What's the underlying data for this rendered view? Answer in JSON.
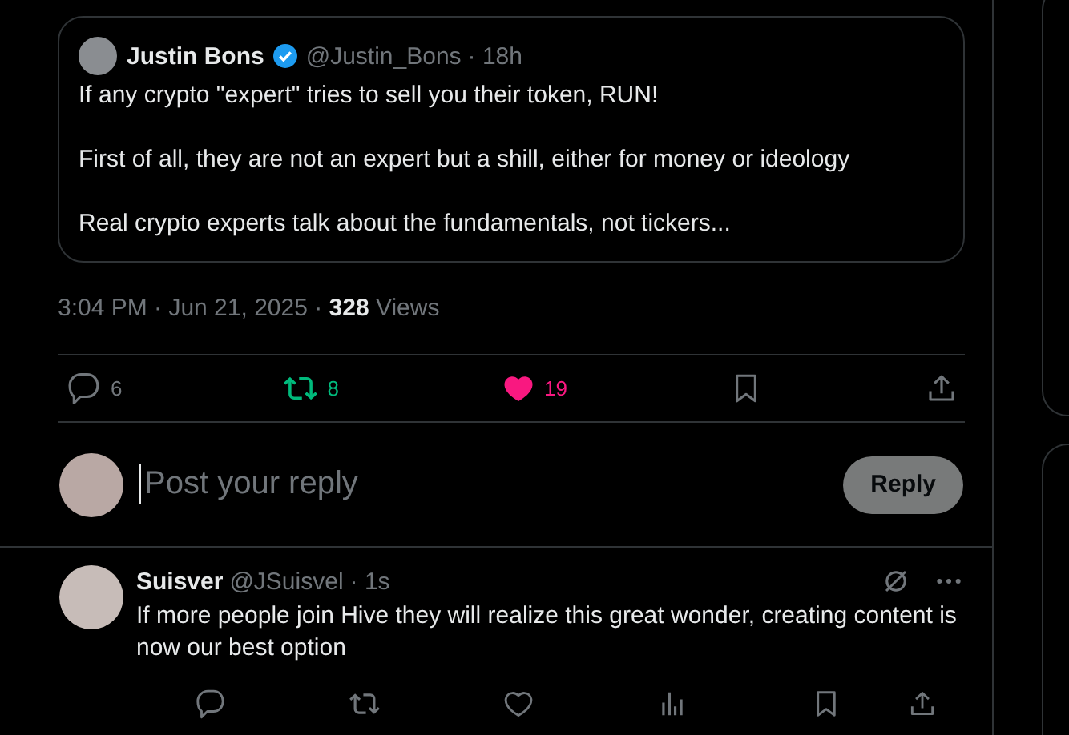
{
  "quoted_post": {
    "author": "Justin Bons",
    "verified": true,
    "handle": "@Justin_Bons",
    "time": "· 18h",
    "text": "If any crypto \"expert\" tries to sell you their token, RUN!\n\nFirst of all, they are not an expert but a shill, either for money or ideology\n\nReal crypto experts talk about the fundamentals, not tickers..."
  },
  "post_meta": "3:04 PM · Jun 21, 2025 · **328** Views",
  "post_actions": [
    {
      "kind": "reply",
      "count": "6",
      "on": false
    },
    {
      "kind": "retweet",
      "count": "8",
      "on": true
    },
    {
      "kind": "like",
      "count": "19",
      "on": true
    },
    {
      "kind": "bookmark",
      "on": false
    },
    {
      "kind": "share"
    }
  ],
  "composer": {
    "placeholder": "Post your reply",
    "button": "Reply",
    "disabled": true
  },
  "reply": {
    "author": "Suisver",
    "handle": "@JSuisvel",
    "time": "· 1s",
    "text": "If more people join Hive they will realize this great wonder, creating content is now our best option",
    "actions": [
      {
        "kind": "reply",
        "on": false
      },
      {
        "kind": "retweet",
        "on": false
      },
      {
        "kind": "like",
        "on": false
      },
      {
        "kind": "views"
      },
      {
        "kind": "bookmark",
        "on": false
      },
      {
        "kind": "share"
      }
    ]
  }
}
